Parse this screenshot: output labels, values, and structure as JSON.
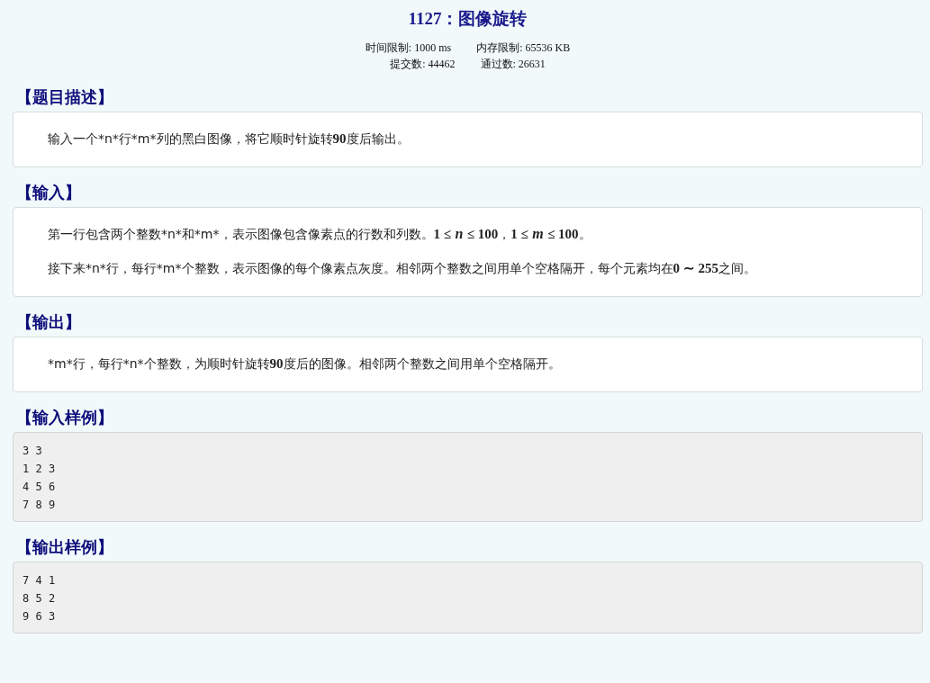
{
  "problem": {
    "title": "1127：图像旋转",
    "stats": [
      [
        "时间限制: 1000 ms",
        "内存限制: 65536 KB"
      ],
      [
        "提交数: 44462",
        "通过数: 26631"
      ]
    ]
  },
  "sections": [
    {
      "kind": "text",
      "heading": "【题目描述】",
      "paragraphs": [
        "输入一个*n*行*m*列的黑白图像，将它顺时针旋转**90**度后输出。"
      ]
    },
    {
      "kind": "text",
      "heading": "【输入】",
      "paragraphs": [
        "第一行包含两个整数*n*和*m*，表示图像包含像素点的行数和列数。**1 ≤** *n* **≤ 100**，**1 ≤** *m* **≤ 100**。",
        "接下来*n*行，每行*m*个整数，表示图像的每个像素点灰度。相邻两个整数之间用单个空格隔开，每个元素均在**0 ∼ 255**之间。"
      ]
    },
    {
      "kind": "text",
      "heading": "【输出】",
      "paragraphs": [
        "*m*行，每行*n*个整数，为顺时针旋转**90**度后的图像。相邻两个整数之间用单个空格隔开。"
      ]
    },
    {
      "kind": "code",
      "heading": "【输入样例】",
      "lines": [
        "3 3",
        "1 2 3",
        "4 5 6",
        "7 8 9"
      ]
    },
    {
      "kind": "code",
      "heading": "【输出样例】",
      "lines": [
        "7 4 1",
        "8 5 2",
        "9 6 3"
      ]
    }
  ]
}
